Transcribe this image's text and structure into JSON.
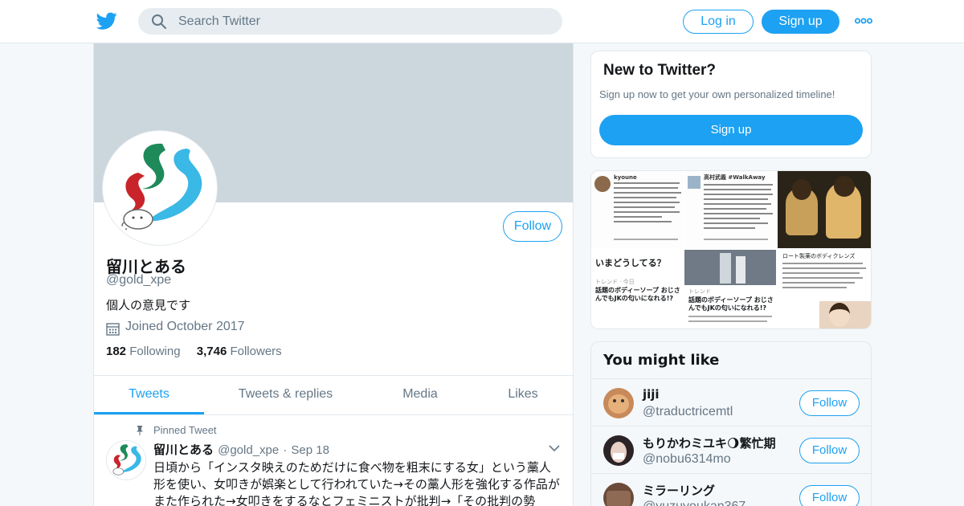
{
  "header": {
    "search_placeholder": "Search Twitter",
    "login_label": "Log in",
    "signup_label": "Sign up",
    "brand_color": "#1da1f2"
  },
  "profile": {
    "name": "留川とある",
    "handle": "@gold_xpe",
    "bio": "個人の意見です",
    "joined": "Joined October 2017",
    "follow_label": "Follow",
    "following_count": "182",
    "following_label": "Following",
    "followers_count": "3,746",
    "followers_label": "Followers"
  },
  "tabs": [
    {
      "label": "Tweets",
      "active": true
    },
    {
      "label": "Tweets & replies",
      "active": false
    },
    {
      "label": "Media",
      "active": false
    },
    {
      "label": "Likes",
      "active": false
    }
  ],
  "pinned_tweet": {
    "pinned_label": "Pinned Tweet",
    "name": "留川とある",
    "handle": "@gold_xpe",
    "separator": "·",
    "date": "Sep 18",
    "text": "日頃から「インスタ映えのためだけに食べ物を粗末にする女」という藁人形を使い、女叩きが娯楽として行われていた→その藁人形を強化する作品がまた作られた→女叩きをするなとフェミニストが批判→「その批判の勢"
  },
  "new_to_twitter": {
    "title": "New to Twitter?",
    "subtitle": "Sign up now to get your own personalized timeline!",
    "button": "Sign up"
  },
  "media_tiles": {
    "t1_user": "kyoune",
    "t2_user": "高村武義 #WalkAway",
    "t4_heading": "いまどうしてる？",
    "t4_trend": "トレンド · 今日",
    "t4_title": "話題のボディーソープ おじさんでもJKの匂いになれる!?",
    "t5_trend": "トレンド",
    "t5_title": "話題のボディーソープ おじさんでもJKの匂いになれる!?",
    "t6_title": "ロート製薬のボディクレンズ"
  },
  "you_might_like": {
    "title": "You might like",
    "follow_label": "Follow",
    "users": [
      {
        "name": "jiji",
        "handle": "@traductricemtl"
      },
      {
        "name": "もりかわミユキ🌖繁忙期",
        "handle": "@nobu6314mo"
      },
      {
        "name": "ミラーリング",
        "handle": "@yuzuyoukan367"
      }
    ]
  }
}
